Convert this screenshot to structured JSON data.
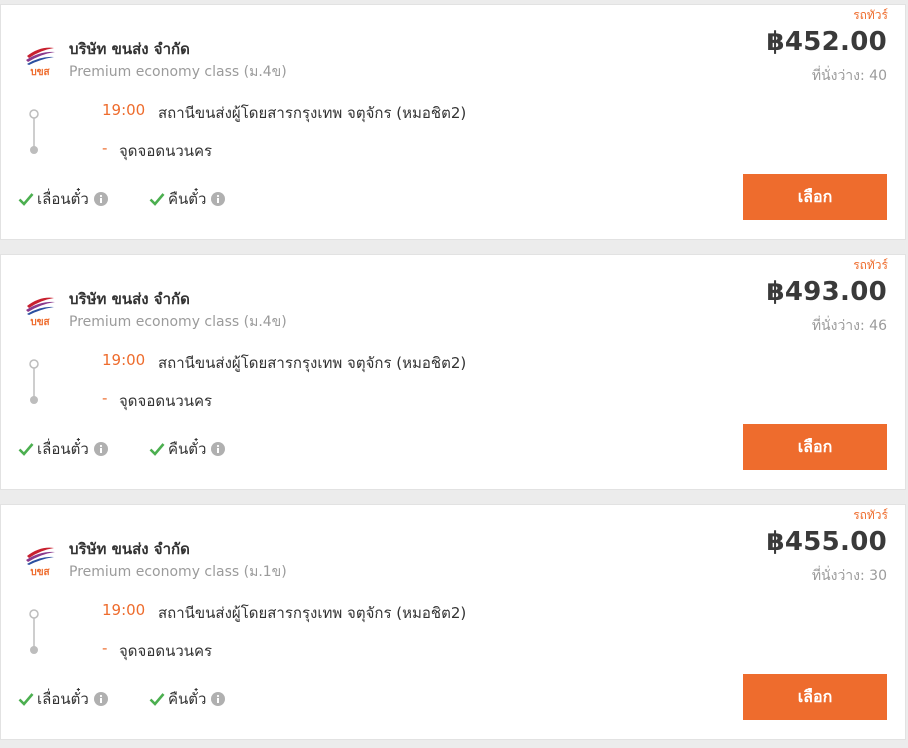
{
  "accent_color": "#ee6c2d",
  "check_color": "#4caf50",
  "trips": [
    {
      "tag": "รถทัวร์",
      "company": "บริษัท ขนส่ง จำกัด",
      "logo_icon": "bks-logo-icon",
      "logo_text": "บขส",
      "bus_class": "Premium economy class (ม.4ข)",
      "price": "฿452.00",
      "seats": "ที่นั่งว่าง: 40",
      "departure_time": "19:00",
      "departure_station": "สถานีขนส่งผู้โดยสารกรุงเทพ จตุจักร (หมอชิต2)",
      "arrival_marker": "-",
      "arrival_station": "จุดจอดนวนคร",
      "feature_1": "เลื่อนตั๋ว",
      "feature_2": "คืนตั๋ว",
      "select_label": "เลือก"
    },
    {
      "tag": "รถทัวร์",
      "company": "บริษัท ขนส่ง จำกัด",
      "logo_icon": "bks-logo-icon",
      "logo_text": "บขส",
      "bus_class": "Premium economy class (ม.4ข)",
      "price": "฿493.00",
      "seats": "ที่นั่งว่าง: 46",
      "departure_time": "19:00",
      "departure_station": "สถานีขนส่งผู้โดยสารกรุงเทพ จตุจักร (หมอชิต2)",
      "arrival_marker": "-",
      "arrival_station": "จุดจอดนวนคร",
      "feature_1": "เลื่อนตั๋ว",
      "feature_2": "คืนตั๋ว",
      "select_label": "เลือก"
    },
    {
      "tag": "รถทัวร์",
      "company": "บริษัท ขนส่ง จำกัด",
      "logo_icon": "bks-logo-icon",
      "logo_text": "บขส",
      "bus_class": "Premium economy class (ม.1ข)",
      "price": "฿455.00",
      "seats": "ที่นั่งว่าง: 30",
      "departure_time": "19:00",
      "departure_station": "สถานีขนส่งผู้โดยสารกรุงเทพ จตุจักร (หมอชิต2)",
      "arrival_marker": "-",
      "arrival_station": "จุดจอดนวนคร",
      "feature_1": "เลื่อนตั๋ว",
      "feature_2": "คืนตั๋ว",
      "select_label": "เลือก"
    }
  ]
}
